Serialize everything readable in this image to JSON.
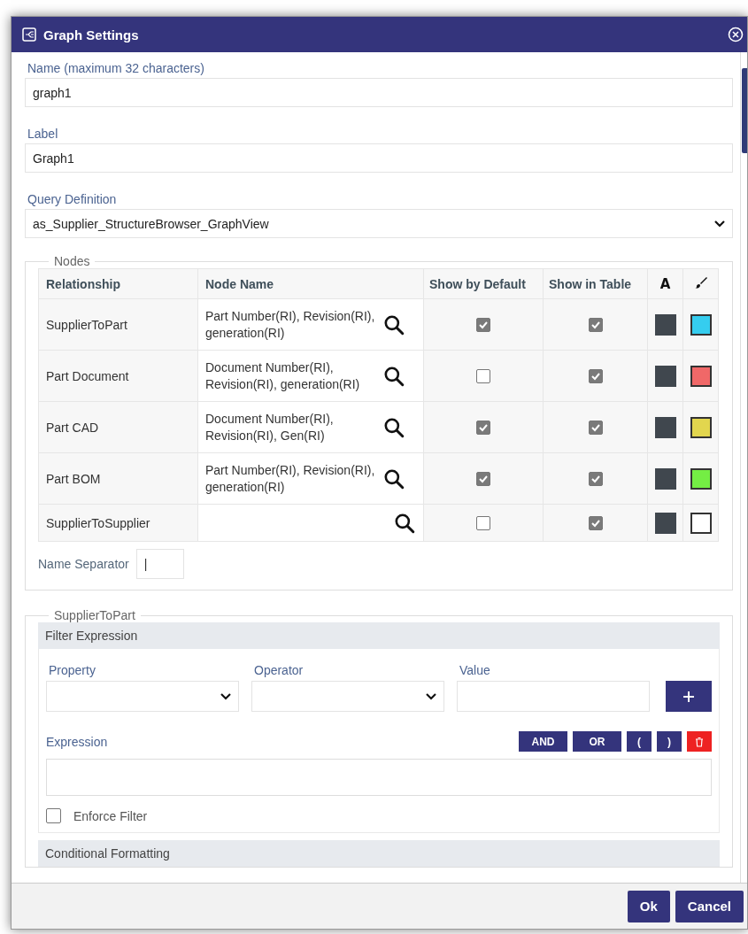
{
  "window": {
    "title": "Graph Settings"
  },
  "fields": [
    {
      "kind": "text",
      "label": "Name (maximum 32 characters)",
      "value": "graph1"
    },
    {
      "kind": "text",
      "label": "Label",
      "value": "Graph1"
    },
    {
      "kind": "select",
      "label": "Query Definition",
      "value": "as_Supplier_StructureBrowser_GraphView"
    }
  ],
  "nodes": {
    "legend": "Nodes",
    "columns": [
      "Relationship",
      "Node Name",
      "Show by Default",
      "Show in Table",
      "A"
    ],
    "rows": [
      {
        "relationship": "SupplierToPart",
        "node_name": "Part Number(RI), Revision(RI), generation(RI)",
        "show_by_default": true,
        "show_in_table": true,
        "swatches": [
          {
            "kind": "font",
            "color": "#40474e"
          },
          {
            "kind": "fill",
            "color": "#35cdef"
          }
        ]
      },
      {
        "relationship": "Part Document",
        "node_name": "Document Number(RI), Revision(RI), generation(RI)",
        "show_by_default": false,
        "show_in_table": true,
        "swatches": [
          {
            "kind": "font",
            "color": "#40474e"
          },
          {
            "kind": "fill",
            "color": "#f06868"
          }
        ]
      },
      {
        "relationship": "Part CAD",
        "node_name": "Document Number(RI), Revision(RI), Gen(RI)",
        "show_by_default": true,
        "show_in_table": true,
        "swatches": [
          {
            "kind": "font",
            "color": "#40474e"
          },
          {
            "kind": "fill",
            "color": "#e2d64e"
          }
        ]
      },
      {
        "relationship": "Part BOM",
        "node_name": "Part Number(RI), Revision(RI), generation(RI)",
        "show_by_default": true,
        "show_in_table": true,
        "swatches": [
          {
            "kind": "font",
            "color": "#40474e"
          },
          {
            "kind": "fill",
            "color": "#74ee44"
          }
        ]
      },
      {
        "relationship": "SupplierToSupplier",
        "show_by_default": false,
        "show_in_table": true,
        "swatches": [
          {
            "kind": "font",
            "color": "#40474e"
          },
          {
            "kind": "fill",
            "color": "#ffffff"
          }
        ]
      }
    ],
    "separator_label": "Name Separator",
    "separator_value": "|"
  },
  "section": {
    "legend": "SupplierToPart",
    "filter": {
      "header": "Filter Expression",
      "property_label": "Property",
      "operator_label": "Operator",
      "value_label": "Value",
      "expression_label": "Expression",
      "operators": [
        "AND",
        "OR",
        "(",
        ")"
      ],
      "enforce_label": "Enforce Filter",
      "enforce_checked": false
    },
    "conditional_header": "Conditional Formatting"
  },
  "buttons": [
    "Ok",
    "Cancel"
  ]
}
